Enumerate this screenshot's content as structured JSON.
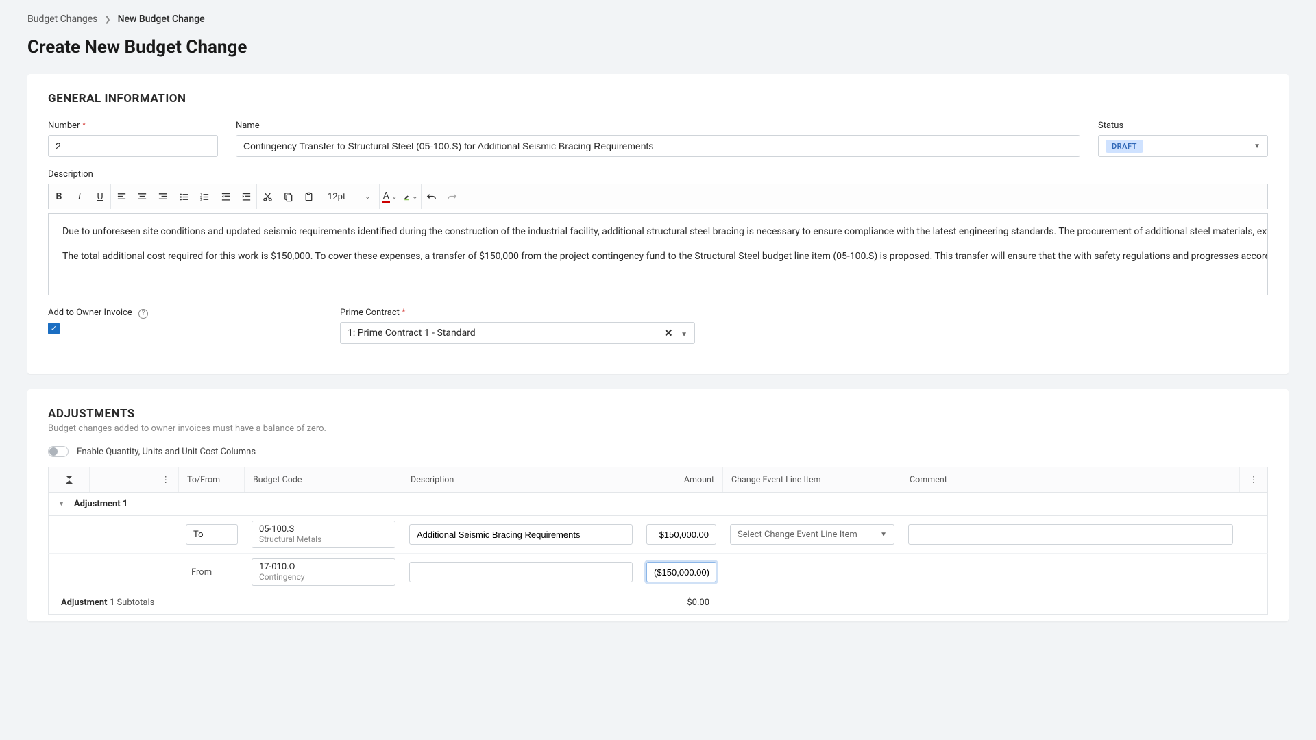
{
  "breadcrumb": {
    "root": "Budget Changes",
    "current": "New Budget Change"
  },
  "page_title": "Create New Budget Change",
  "general": {
    "section": "GENERAL INFORMATION",
    "number_label": "Number",
    "number_value": "2",
    "name_label": "Name",
    "name_value": "Contingency Transfer to Structural Steel (05-100.S) for Additional Seismic Bracing Requirements",
    "status_label": "Status",
    "status_value": "DRAFT",
    "description_label": "Description",
    "font_size": "12pt",
    "desc_p1": "Due to unforeseen site conditions and updated seismic requirements identified during the construction of the industrial facility, additional structural steel bracing is necessary to ensure compliance with the latest engineering standards. The procurement of additional steel materials, extended labor for fabrication and erection, increased equipment rental costs, and engineering design adjustments.",
    "desc_p2": "The total additional cost required for this work is $150,000. To cover these expenses, a transfer of $150,000 from the project contingency fund to the Structural Steel budget line item (05-100.S) is proposed. This transfer will ensure that the with safety regulations and progresses according to schedule.",
    "owner_invoice_label": "Add to Owner Invoice",
    "prime_label": "Prime Contract",
    "prime_value": "1: Prime Contract 1 - Standard"
  },
  "adjustments": {
    "section": "ADJUSTMENTS",
    "hint": "Budget changes added to owner invoices must have a balance of zero.",
    "toggle_label": "Enable Quantity, Units and Unit Cost Columns",
    "headers": {
      "tofrom": "To/From",
      "budget_code": "Budget Code",
      "description": "Description",
      "amount": "Amount",
      "change_event": "Change Event Line Item",
      "comment": "Comment"
    },
    "group_label": "Adjustment 1",
    "row_to": {
      "dir": "To",
      "code": "05-100.S",
      "code_sub": "Structural Metals",
      "desc": "Additional Seismic Bracing Requirements",
      "amount": "$150,000.00",
      "change_event_placeholder": "Select Change Event Line Item"
    },
    "row_from": {
      "dir": "From",
      "code": "17-010.O",
      "code_sub": "Contingency",
      "desc": "",
      "amount": "($150,000.00)"
    },
    "subtotal_label": "Adjustment 1",
    "subtotal_suffix": "Subtotals",
    "subtotal_amount": "$0.00"
  }
}
